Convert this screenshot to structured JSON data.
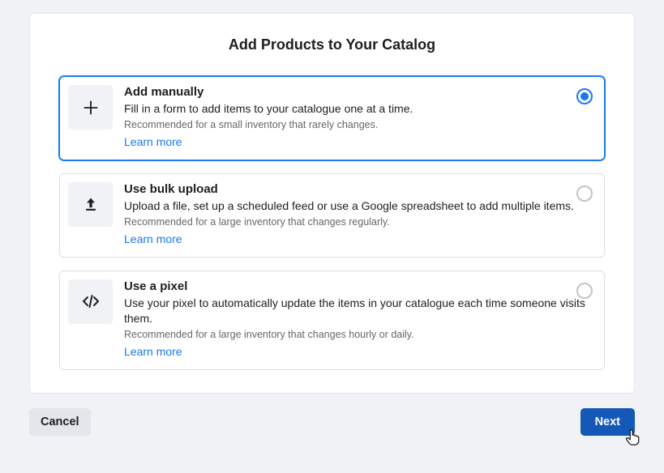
{
  "title": "Add Products to Your Catalog",
  "options": [
    {
      "title": "Add manually",
      "desc": "Fill in a form to add items to your catalogue one at a time.",
      "rec": "Recommended for a small inventory that rarely changes.",
      "learn": "Learn more",
      "selected": true
    },
    {
      "title": "Use bulk upload",
      "desc": "Upload a file, set up a scheduled feed or use a Google spreadsheet to add multiple items.",
      "rec": "Recommended for a large inventory that changes regularly.",
      "learn": "Learn more",
      "selected": false
    },
    {
      "title": "Use a pixel",
      "desc": "Use your pixel to automatically update the items in your catalogue each time someone visits them.",
      "rec": "Recommended for a large inventory that changes hourly or daily.",
      "learn": "Learn more",
      "selected": false
    }
  ],
  "buttons": {
    "cancel": "Cancel",
    "next": "Next"
  }
}
